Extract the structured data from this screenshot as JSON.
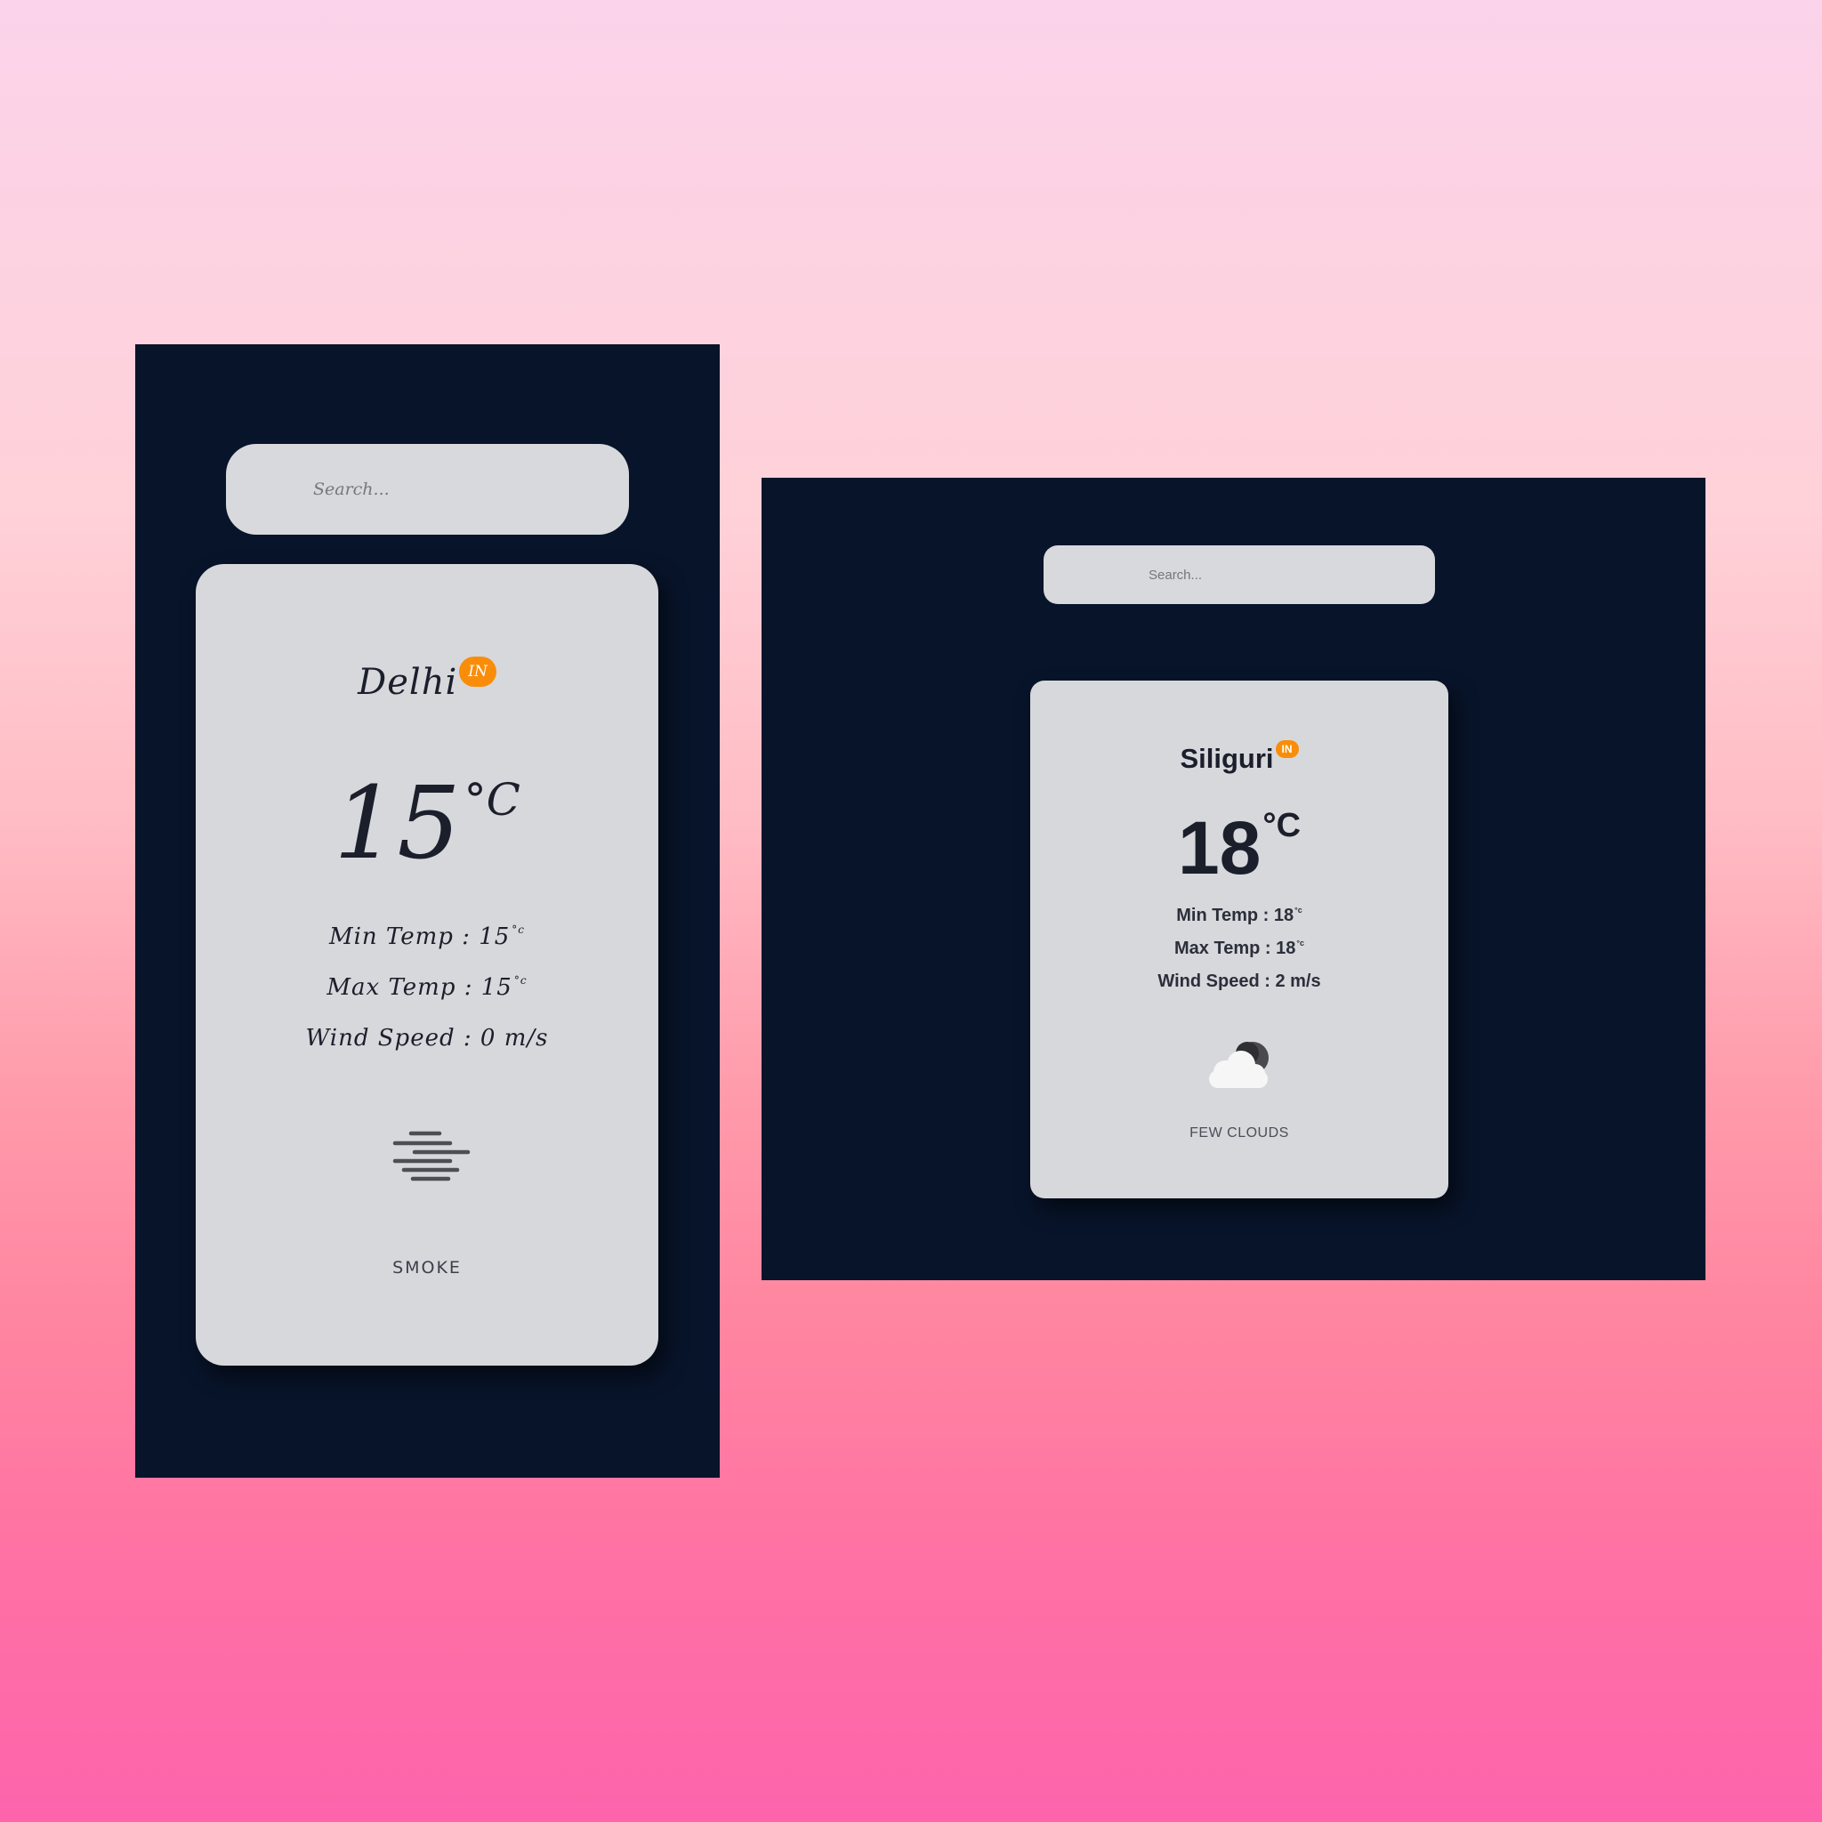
{
  "widgets": [
    {
      "search_placeholder": "Search...",
      "city": "Delhi",
      "country_badge": "IN",
      "temperature": "15",
      "temperature_unit": "°C",
      "min_temp_label": "Min Temp :",
      "min_temp_value": "15",
      "max_temp_label": "Max Temp :",
      "max_temp_value": "15",
      "small_unit": "°c",
      "wind_speed_label": "Wind Speed :",
      "wind_speed_value": "0 m/s",
      "weather_icon": "haze-icon",
      "description": "SMOKE"
    },
    {
      "search_placeholder": "Search...",
      "city": "Siliguri",
      "country_badge": "IN",
      "temperature": "18",
      "temperature_unit": "°C",
      "min_temp_label": "Min Temp :",
      "min_temp_value": "18",
      "max_temp_label": "Max Temp :",
      "max_temp_value": "18",
      "small_unit": "°c",
      "wind_speed_label": "Wind Speed :",
      "wind_speed_value": "2 m/s",
      "weather_icon": "few-clouds-night-icon",
      "description": "FEW CLOUDS"
    }
  ],
  "colors": {
    "page_background_top": "#fbd3ea",
    "page_background_bottom": "#fd64ac",
    "frame_background": "#08142a",
    "card_background": "#d7d8dc",
    "badge_background": "#f98d0a",
    "text_primary": "#1b1f2b"
  }
}
